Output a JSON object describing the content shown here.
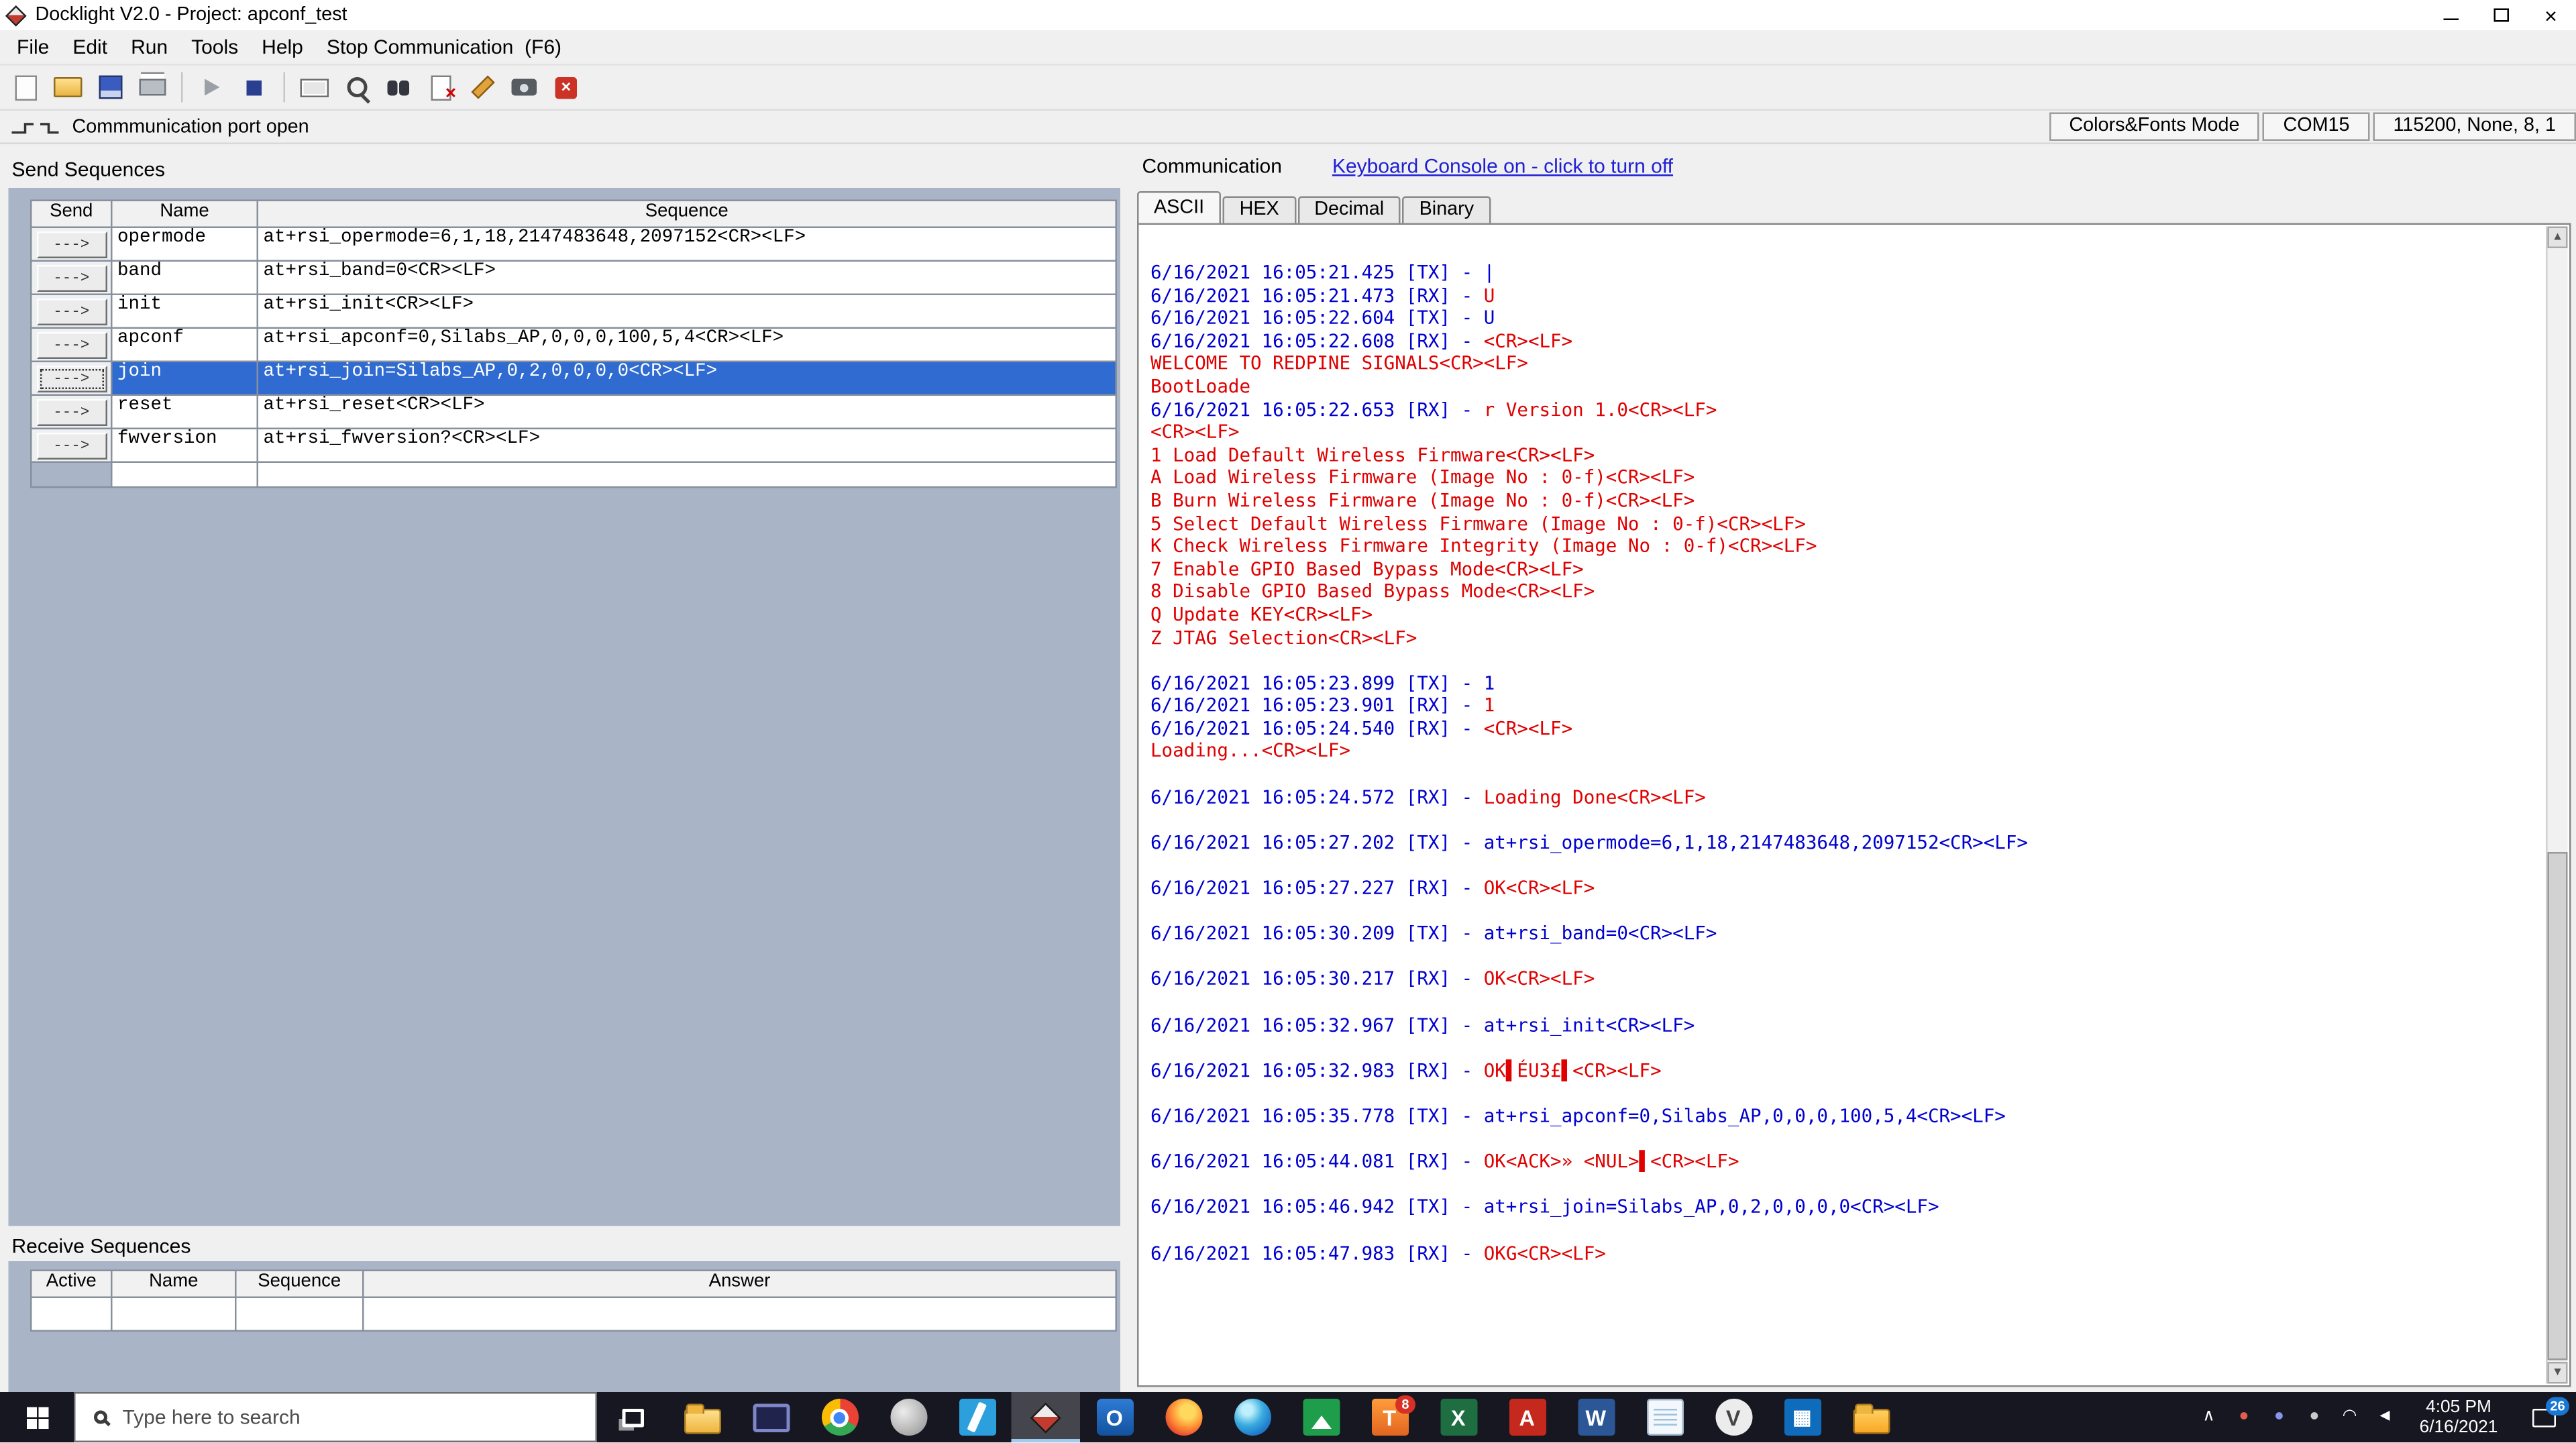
{
  "window": {
    "title": "Docklight V2.0 - Project: apconf_test"
  },
  "menu": {
    "items": [
      {
        "id": "file",
        "label": "File"
      },
      {
        "id": "edit",
        "label": "Edit"
      },
      {
        "id": "run",
        "label": "Run"
      },
      {
        "id": "tools",
        "label": "Tools"
      },
      {
        "id": "help",
        "label": "Help"
      },
      {
        "id": "stop-communication",
        "label": "Stop Communication  (F6)"
      }
    ]
  },
  "toolbar": {
    "buttons": [
      {
        "id": "new"
      },
      {
        "id": "open"
      },
      {
        "id": "save"
      },
      {
        "id": "print"
      },
      {
        "id": "sep"
      },
      {
        "id": "start-comm"
      },
      {
        "id": "stop-comm"
      },
      {
        "id": "sep"
      },
      {
        "id": "settings"
      },
      {
        "id": "monitor"
      },
      {
        "id": "find"
      },
      {
        "id": "clear"
      },
      {
        "id": "edit-seq"
      },
      {
        "id": "snapshot"
      },
      {
        "id": "comm-error"
      }
    ]
  },
  "status_strip": {
    "status_text": "Commmunication port open",
    "mode_box": "Colors&Fonts Mode",
    "port_box": "COM15",
    "settings_box": "115200, None, 8, 1"
  },
  "send_sequences": {
    "title": "Send Sequences",
    "columns": [
      "Send",
      "Name",
      "Sequence"
    ],
    "arrow_label": "--->",
    "selected_index": 4,
    "rows": [
      {
        "name": "opermode",
        "sequence": "at+rsi_opermode=6,1,18,2147483648,2097152<CR><LF>"
      },
      {
        "name": "band",
        "sequence": "at+rsi_band=0<CR><LF>"
      },
      {
        "name": "init",
        "sequence": "at+rsi_init<CR><LF>"
      },
      {
        "name": "apconf",
        "sequence": "at+rsi_apconf=0,Silabs_AP,0,0,0,100,5,4<CR><LF>"
      },
      {
        "name": "join",
        "sequence": "at+rsi_join=Silabs_AP,0,2,0,0,0,0<CR><LF>"
      },
      {
        "name": "reset",
        "sequence": "at+rsi_reset<CR><LF>"
      },
      {
        "name": "fwversion",
        "sequence": "at+rsi_fwversion?<CR><LF>"
      }
    ]
  },
  "receive_sequences": {
    "title": "Receive Sequences",
    "columns": [
      "Active",
      "Name",
      "Sequence",
      "Answer"
    ]
  },
  "communication": {
    "title": "Communication",
    "keyboard_link": "Keyboard Console on - click to turn off",
    "tabs": [
      "ASCII",
      "HEX",
      "Decimal",
      "Binary"
    ],
    "active_tab": "ASCII",
    "colors": {
      "timestamp_tx": "#0000d0",
      "rx_data": "#e00000"
    },
    "log": [
      {
        "parts": [
          [
            "b",
            "6/16/2021 16:05:21.425 [TX] - |"
          ]
        ]
      },
      {
        "parts": [
          [
            "b",
            "6/16/2021 16:05:21.473 [RX] - "
          ],
          [
            "r",
            "U"
          ]
        ]
      },
      {
        "parts": [
          [
            "b",
            "6/16/2021 16:05:22.604 [TX] - U"
          ]
        ]
      },
      {
        "parts": [
          [
            "b",
            "6/16/2021 16:05:22.608 [RX] - "
          ],
          [
            "r",
            "<CR><LF>"
          ]
        ]
      },
      {
        "parts": [
          [
            "r",
            "WELCOME TO REDPINE SIGNALS<CR><LF>"
          ]
        ]
      },
      {
        "parts": [
          [
            "r",
            "BootLoade"
          ]
        ]
      },
      {
        "parts": [
          [
            "b",
            "6/16/2021 16:05:22.653 [RX] - "
          ],
          [
            "r",
            "r Version 1.0<CR><LF>"
          ]
        ]
      },
      {
        "parts": [
          [
            "r",
            "<CR><LF>"
          ]
        ]
      },
      {
        "parts": [
          [
            "r",
            "1 Load Default Wireless Firmware<CR><LF>"
          ]
        ]
      },
      {
        "parts": [
          [
            "r",
            "A Load Wireless Firmware (Image No : 0-f)<CR><LF>"
          ]
        ]
      },
      {
        "parts": [
          [
            "r",
            "B Burn Wireless Firmware (Image No : 0-f)<CR><LF>"
          ]
        ]
      },
      {
        "parts": [
          [
            "r",
            "5 Select Default Wireless Firmware (Image No : 0-f)<CR><LF>"
          ]
        ]
      },
      {
        "parts": [
          [
            "r",
            "K Check Wireless Firmware Integrity (Image No : 0-f)<CR><LF>"
          ]
        ]
      },
      {
        "parts": [
          [
            "r",
            "7 Enable GPIO Based Bypass Mode<CR><LF>"
          ]
        ]
      },
      {
        "parts": [
          [
            "r",
            "8 Disable GPIO Based Bypass Mode<CR><LF>"
          ]
        ]
      },
      {
        "parts": [
          [
            "r",
            "Q Update KEY<CR><LF>"
          ]
        ]
      },
      {
        "parts": [
          [
            "r",
            "Z JTAG Selection<CR><LF>"
          ]
        ]
      },
      {
        "parts": []
      },
      {
        "parts": [
          [
            "b",
            "6/16/2021 16:05:23.899 [TX] - 1"
          ]
        ]
      },
      {
        "parts": [
          [
            "b",
            "6/16/2021 16:05:23.901 [RX] - "
          ],
          [
            "r",
            "1"
          ]
        ]
      },
      {
        "parts": [
          [
            "b",
            "6/16/2021 16:05:24.540 [RX] - "
          ],
          [
            "r",
            "<CR><LF>"
          ]
        ]
      },
      {
        "parts": [
          [
            "r",
            "Loading...<CR><LF>"
          ]
        ]
      },
      {
        "parts": []
      },
      {
        "parts": [
          [
            "b",
            "6/16/2021 16:05:24.572 [RX] - "
          ],
          [
            "r",
            "Loading Done<CR><LF>"
          ]
        ]
      },
      {
        "parts": []
      },
      {
        "parts": [
          [
            "b",
            "6/16/2021 16:05:27.202 [TX] - at+rsi_opermode=6,1,18,2147483648,2097152<CR><LF>"
          ]
        ]
      },
      {
        "parts": []
      },
      {
        "parts": [
          [
            "b",
            "6/16/2021 16:05:27.227 [RX] - "
          ],
          [
            "r",
            "OK<CR><LF>"
          ]
        ]
      },
      {
        "parts": []
      },
      {
        "parts": [
          [
            "b",
            "6/16/2021 16:05:30.209 [TX] - at+rsi_band=0<CR><LF>"
          ]
        ]
      },
      {
        "parts": []
      },
      {
        "parts": [
          [
            "b",
            "6/16/2021 16:05:30.217 [RX] - "
          ],
          [
            "r",
            "OK<CR><LF>"
          ]
        ]
      },
      {
        "parts": []
      },
      {
        "parts": [
          [
            "b",
            "6/16/2021 16:05:32.967 [TX] - at+rsi_init<CR><LF>"
          ]
        ]
      },
      {
        "parts": []
      },
      {
        "parts": [
          [
            "b",
            "6/16/2021 16:05:32.983 [RX] - "
          ],
          [
            "r",
            "OK▌ÉU3£▌<CR><LF>"
          ]
        ]
      },
      {
        "parts": []
      },
      {
        "parts": [
          [
            "b",
            "6/16/2021 16:05:35.778 [TX] - at+rsi_apconf=0,Silabs_AP,0,0,0,100,5,4<CR><LF>"
          ]
        ]
      },
      {
        "parts": []
      },
      {
        "parts": [
          [
            "b",
            "6/16/2021 16:05:44.081 [RX] - "
          ],
          [
            "r",
            "OK<ACK>» <NUL>▌<CR><LF>"
          ]
        ]
      },
      {
        "parts": []
      },
      {
        "parts": [
          [
            "b",
            "6/16/2021 16:05:46.942 [TX] - at+rsi_join=Silabs_AP,0,2,0,0,0,0<CR><LF>"
          ]
        ]
      },
      {
        "parts": []
      },
      {
        "parts": [
          [
            "b",
            "6/16/2021 16:05:47.983 [RX] - "
          ],
          [
            "r",
            "OKG<CR><LF>"
          ]
        ]
      }
    ]
  },
  "taskbar": {
    "search_placeholder": "Type here to search",
    "apps": [
      {
        "name": "file-explorer",
        "glyph": ""
      },
      {
        "name": "monitor-app",
        "glyph": ""
      },
      {
        "name": "chrome",
        "glyph": ""
      },
      {
        "name": "gray-app",
        "glyph": ""
      },
      {
        "name": "vscode",
        "glyph": ""
      },
      {
        "name": "docklight",
        "glyph": "",
        "active": true
      },
      {
        "name": "outlook",
        "glyph": "O"
      },
      {
        "name": "firefox",
        "glyph": ""
      },
      {
        "name": "edge",
        "glyph": ""
      },
      {
        "name": "snipping",
        "glyph": ""
      },
      {
        "name": "teraterm",
        "glyph": "T",
        "badge": "8"
      },
      {
        "name": "excel",
        "glyph": "X"
      },
      {
        "name": "acrobat",
        "glyph": "A"
      },
      {
        "name": "word",
        "glyph": "W"
      },
      {
        "name": "notepad",
        "glyph": ""
      },
      {
        "name": "v-app",
        "glyph": "V"
      },
      {
        "name": "calculator",
        "glyph": "▦"
      },
      {
        "name": "folder2",
        "glyph": ""
      }
    ],
    "tray": [
      {
        "name": "hidden-icons-chevron",
        "glyph": "∧",
        "color": "#ffffff"
      },
      {
        "name": "tray-app-red",
        "glyph": "●",
        "color": "#e25d4e"
      },
      {
        "name": "tray-app-purple",
        "glyph": "●",
        "color": "#8a93e8"
      },
      {
        "name": "tray-app-gray",
        "glyph": "●",
        "color": "#c9c9c9"
      },
      {
        "name": "network",
        "glyph": "◠",
        "color": "#ffffff"
      },
      {
        "name": "volume",
        "glyph": "◄",
        "color": "#ffffff"
      }
    ],
    "clock": {
      "time": "4:05 PM",
      "date": "6/16/2021"
    },
    "notifications": {
      "count": "26"
    }
  }
}
